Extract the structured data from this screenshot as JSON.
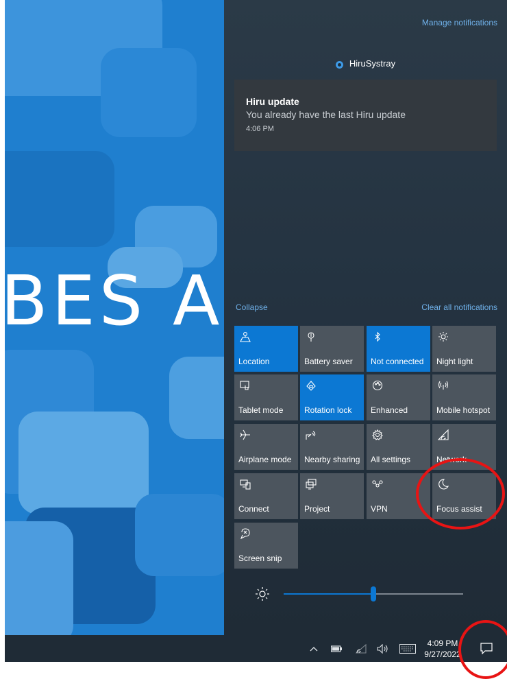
{
  "wallpaper": {
    "text": "BES A"
  },
  "action_center": {
    "manage_label": "Manage notifications",
    "app_name": "HiruSystray",
    "notification": {
      "title": "Hiru update",
      "body": "You already have the last Hiru update",
      "time": "4:06 PM"
    },
    "collapse_label": "Collapse",
    "clear_label": "Clear all notifications",
    "tiles": [
      {
        "label": "Location",
        "icon": "location-icon",
        "active": true
      },
      {
        "label": "Battery saver",
        "icon": "battery-saver-icon",
        "active": false
      },
      {
        "label": "Not connected",
        "icon": "bluetooth-icon",
        "active": true
      },
      {
        "label": "Night light",
        "icon": "night-light-icon",
        "active": false
      },
      {
        "label": "Tablet mode",
        "icon": "tablet-mode-icon",
        "active": false
      },
      {
        "label": "Rotation lock",
        "icon": "rotation-lock-icon",
        "active": true
      },
      {
        "label": "Enhanced",
        "icon": "palette-icon",
        "active": false
      },
      {
        "label": "Mobile hotspot",
        "icon": "mobile-hotspot-icon",
        "active": false
      },
      {
        "label": "Airplane mode",
        "icon": "airplane-icon",
        "active": false
      },
      {
        "label": "Nearby sharing",
        "icon": "nearby-sharing-icon",
        "active": false
      },
      {
        "label": "All settings",
        "icon": "gear-icon",
        "active": false
      },
      {
        "label": "Network",
        "icon": "network-icon",
        "active": false
      },
      {
        "label": "Connect",
        "icon": "connect-icon",
        "active": false
      },
      {
        "label": "Project",
        "icon": "project-icon",
        "active": false
      },
      {
        "label": "VPN",
        "icon": "vpn-icon",
        "active": false
      },
      {
        "label": "Focus assist",
        "icon": "moon-icon",
        "active": false
      },
      {
        "label": "Screen snip",
        "icon": "screen-snip-icon",
        "active": false
      }
    ],
    "brightness_percent": 50
  },
  "taskbar": {
    "time": "4:09 PM",
    "date": "9/27/2022",
    "tray_icons": [
      "chevron-up-icon",
      "battery-icon",
      "wifi-icon",
      "volume-icon",
      "keyboard-icon"
    ]
  },
  "colors": {
    "active_tile": "#0c78d3",
    "inactive_tile": "#4c555e",
    "link": "#6fb0e8",
    "annotation": "#e81414",
    "wallpaper": "#1f7fcf"
  }
}
